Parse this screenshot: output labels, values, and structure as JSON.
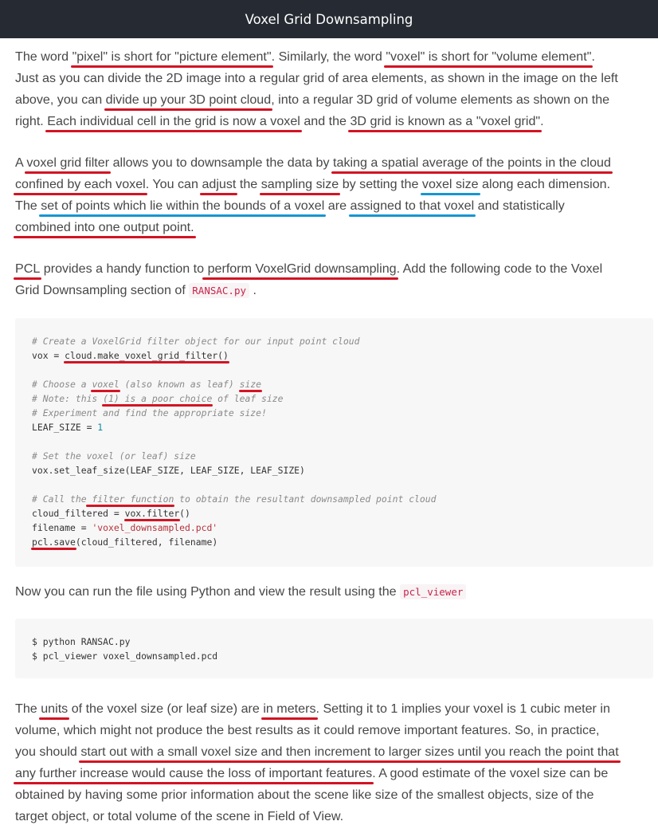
{
  "header": {
    "title": "Voxel Grid Downsampling"
  },
  "p1": {
    "l1": [
      "The word ",
      "\"pixel\" is short for \"picture element\"",
      ". Similarly, the word ",
      "\"voxel\" is short for \"volume element\"",
      "."
    ],
    "l2": "Just as you can divide the 2D image into a regular grid of area elements, as shown in the image on the left",
    "l3": [
      "above, you can ",
      "divide up your 3D point cloud",
      ", into a regular 3D grid of volume elements as shown on the"
    ],
    "l4": [
      "right. ",
      "Each individual cell in the grid is now a voxel",
      " and the ",
      "3D grid is known as a \"voxel grid\"",
      "."
    ]
  },
  "p2": {
    "l1": [
      "A ",
      "voxel grid filter",
      " allows you to downsample the data by ",
      "taking a spatial average of the points in the cloud"
    ],
    "l2": [
      "confined by each voxel",
      ". You can ",
      "adjust",
      " the ",
      "sampling size",
      " by setting the ",
      "voxel size",
      " along each dimension."
    ],
    "l3": [
      "The ",
      "set of points which lie within the bounds of a voxel",
      " are ",
      "assigned to that voxel",
      " and statistically"
    ],
    "l4": [
      "combined into one output point."
    ]
  },
  "p3": {
    "l1": [
      "PCL",
      " provides a handy function to",
      " perform VoxelGrid downsampling",
      ". Add the following code to the Voxel"
    ],
    "l2": [
      "Grid Downsampling section of ",
      "RANSAC.py",
      " ."
    ]
  },
  "code1": {
    "c1": "# Create a VoxelGrid filter object for our input point cloud",
    "c2": [
      "vox = ",
      "cloud.make_voxel_grid_filter()"
    ],
    "c3": [
      "# Choose a ",
      "voxel",
      " (also known as leaf) ",
      "size"
    ],
    "c4": [
      "# Note: this ",
      "(1) is a poor choice",
      " of leaf size"
    ],
    "c5": "# Experiment and find the appropriate size!",
    "c6": [
      "LEAF_SIZE = ",
      "1"
    ],
    "c7": "# Set the voxel (or leaf) size",
    "c8": "vox.set_leaf_size(LEAF_SIZE, LEAF_SIZE, LEAF_SIZE)",
    "c9": [
      "# Call the",
      " filter function",
      " to obtain the resultant downsampled point cloud"
    ],
    "c10": [
      "cloud_filtered = ",
      "vox.filter",
      "()"
    ],
    "c11": [
      "filename = ",
      "'voxel_downsampled.pcd'"
    ],
    "c12": [
      "pcl.save",
      "(cloud_filtered, filename)"
    ]
  },
  "p4": {
    "l1": [
      "Now you can run the file using Python and view the result using the ",
      "pcl_viewer"
    ]
  },
  "code2": {
    "c1": "$ python RANSAC.py",
    "c2": "$ pcl_viewer voxel_downsampled.pcd"
  },
  "p5": {
    "l1": [
      "The ",
      "units",
      " of the voxel size (or leaf size) are ",
      "in meters",
      ". Setting it to 1 implies your voxel is 1 cubic meter in"
    ],
    "l2": "volume, which might not produce the best results as it could remove important features. So, in practice,",
    "l3": [
      "you should ",
      "start out with a small voxel size and then increment to larger sizes until you reach the point that"
    ],
    "l4": [
      "any further increase would cause the loss of important features",
      ". A good estimate of the voxel size can be"
    ],
    "l5": "obtained by having some prior information about the scene like size of the smallest objects, size of the",
    "l6": "target object, or total volume of the scene in Field of View."
  },
  "colors": {
    "underline_red": "#d21423",
    "underline_blue": "#1696d2",
    "topbar": "#262b33"
  }
}
